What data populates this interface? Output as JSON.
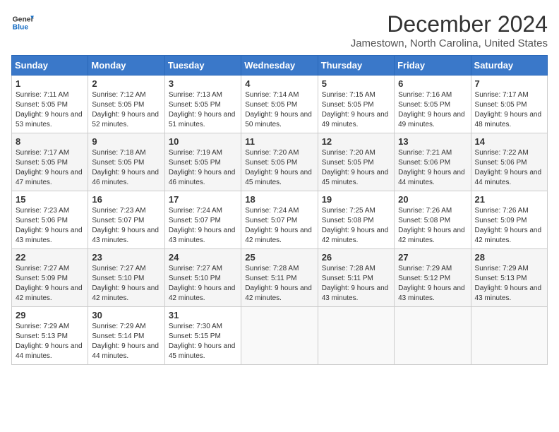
{
  "header": {
    "logo_line1": "General",
    "logo_line2": "Blue",
    "title": "December 2024",
    "subtitle": "Jamestown, North Carolina, United States"
  },
  "days_of_week": [
    "Sunday",
    "Monday",
    "Tuesday",
    "Wednesday",
    "Thursday",
    "Friday",
    "Saturday"
  ],
  "weeks": [
    [
      {
        "day": "1",
        "info": "Sunrise: 7:11 AM\nSunset: 5:05 PM\nDaylight: 9 hours and 53 minutes."
      },
      {
        "day": "2",
        "info": "Sunrise: 7:12 AM\nSunset: 5:05 PM\nDaylight: 9 hours and 52 minutes."
      },
      {
        "day": "3",
        "info": "Sunrise: 7:13 AM\nSunset: 5:05 PM\nDaylight: 9 hours and 51 minutes."
      },
      {
        "day": "4",
        "info": "Sunrise: 7:14 AM\nSunset: 5:05 PM\nDaylight: 9 hours and 50 minutes."
      },
      {
        "day": "5",
        "info": "Sunrise: 7:15 AM\nSunset: 5:05 PM\nDaylight: 9 hours and 49 minutes."
      },
      {
        "day": "6",
        "info": "Sunrise: 7:16 AM\nSunset: 5:05 PM\nDaylight: 9 hours and 49 minutes."
      },
      {
        "day": "7",
        "info": "Sunrise: 7:17 AM\nSunset: 5:05 PM\nDaylight: 9 hours and 48 minutes."
      }
    ],
    [
      {
        "day": "8",
        "info": "Sunrise: 7:17 AM\nSunset: 5:05 PM\nDaylight: 9 hours and 47 minutes."
      },
      {
        "day": "9",
        "info": "Sunrise: 7:18 AM\nSunset: 5:05 PM\nDaylight: 9 hours and 46 minutes."
      },
      {
        "day": "10",
        "info": "Sunrise: 7:19 AM\nSunset: 5:05 PM\nDaylight: 9 hours and 46 minutes."
      },
      {
        "day": "11",
        "info": "Sunrise: 7:20 AM\nSunset: 5:05 PM\nDaylight: 9 hours and 45 minutes."
      },
      {
        "day": "12",
        "info": "Sunrise: 7:20 AM\nSunset: 5:05 PM\nDaylight: 9 hours and 45 minutes."
      },
      {
        "day": "13",
        "info": "Sunrise: 7:21 AM\nSunset: 5:06 PM\nDaylight: 9 hours and 44 minutes."
      },
      {
        "day": "14",
        "info": "Sunrise: 7:22 AM\nSunset: 5:06 PM\nDaylight: 9 hours and 44 minutes."
      }
    ],
    [
      {
        "day": "15",
        "info": "Sunrise: 7:23 AM\nSunset: 5:06 PM\nDaylight: 9 hours and 43 minutes."
      },
      {
        "day": "16",
        "info": "Sunrise: 7:23 AM\nSunset: 5:07 PM\nDaylight: 9 hours and 43 minutes."
      },
      {
        "day": "17",
        "info": "Sunrise: 7:24 AM\nSunset: 5:07 PM\nDaylight: 9 hours and 43 minutes."
      },
      {
        "day": "18",
        "info": "Sunrise: 7:24 AM\nSunset: 5:07 PM\nDaylight: 9 hours and 42 minutes."
      },
      {
        "day": "19",
        "info": "Sunrise: 7:25 AM\nSunset: 5:08 PM\nDaylight: 9 hours and 42 minutes."
      },
      {
        "day": "20",
        "info": "Sunrise: 7:26 AM\nSunset: 5:08 PM\nDaylight: 9 hours and 42 minutes."
      },
      {
        "day": "21",
        "info": "Sunrise: 7:26 AM\nSunset: 5:09 PM\nDaylight: 9 hours and 42 minutes."
      }
    ],
    [
      {
        "day": "22",
        "info": "Sunrise: 7:27 AM\nSunset: 5:09 PM\nDaylight: 9 hours and 42 minutes."
      },
      {
        "day": "23",
        "info": "Sunrise: 7:27 AM\nSunset: 5:10 PM\nDaylight: 9 hours and 42 minutes."
      },
      {
        "day": "24",
        "info": "Sunrise: 7:27 AM\nSunset: 5:10 PM\nDaylight: 9 hours and 42 minutes."
      },
      {
        "day": "25",
        "info": "Sunrise: 7:28 AM\nSunset: 5:11 PM\nDaylight: 9 hours and 42 minutes."
      },
      {
        "day": "26",
        "info": "Sunrise: 7:28 AM\nSunset: 5:11 PM\nDaylight: 9 hours and 43 minutes."
      },
      {
        "day": "27",
        "info": "Sunrise: 7:29 AM\nSunset: 5:12 PM\nDaylight: 9 hours and 43 minutes."
      },
      {
        "day": "28",
        "info": "Sunrise: 7:29 AM\nSunset: 5:13 PM\nDaylight: 9 hours and 43 minutes."
      }
    ],
    [
      {
        "day": "29",
        "info": "Sunrise: 7:29 AM\nSunset: 5:13 PM\nDaylight: 9 hours and 44 minutes."
      },
      {
        "day": "30",
        "info": "Sunrise: 7:29 AM\nSunset: 5:14 PM\nDaylight: 9 hours and 44 minutes."
      },
      {
        "day": "31",
        "info": "Sunrise: 7:30 AM\nSunset: 5:15 PM\nDaylight: 9 hours and 45 minutes."
      },
      {
        "day": "",
        "info": ""
      },
      {
        "day": "",
        "info": ""
      },
      {
        "day": "",
        "info": ""
      },
      {
        "day": "",
        "info": ""
      }
    ]
  ]
}
